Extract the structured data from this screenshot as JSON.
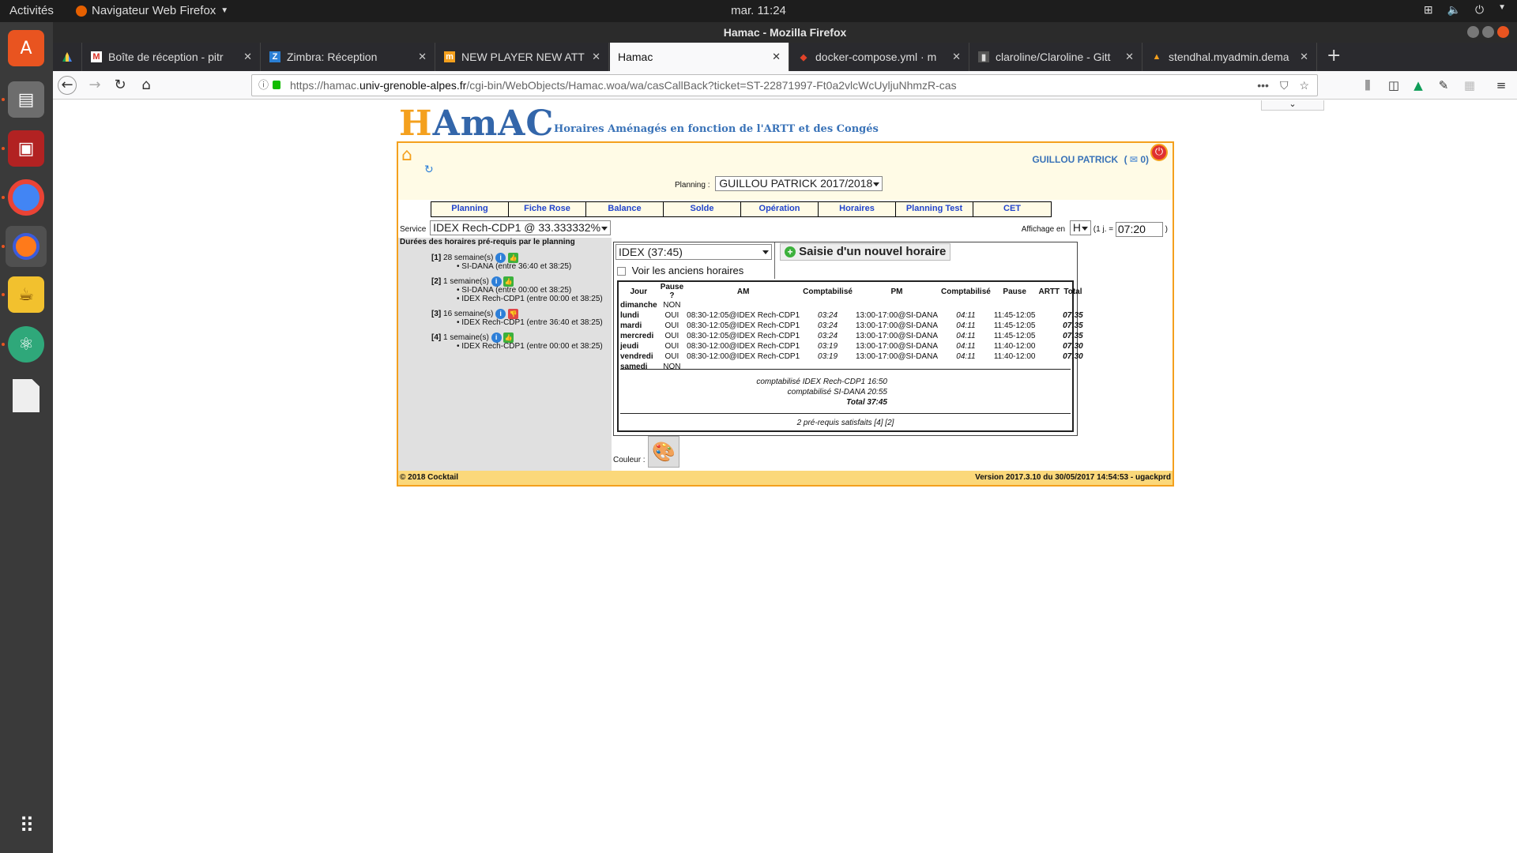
{
  "system": {
    "activities": "Activités",
    "app_menu": "Navigateur Web Firefox",
    "clock": "mar. 11:24"
  },
  "window": {
    "title": "Hamac - Mozilla Firefox"
  },
  "tabs": [
    {
      "label": "Boîte de réception - pitr",
      "icon": "gmail-icon",
      "color": "#d93025"
    },
    {
      "label": "Zimbra: Réception",
      "icon": "zimbra-icon",
      "color": "#2a7fd4"
    },
    {
      "label": "NEW PLAYER NEW ATTIT",
      "icon": "bookmark-icon",
      "color": "#f4a01d"
    },
    {
      "label": "Hamac",
      "icon": "",
      "color": "#ffffff"
    },
    {
      "label": "docker-compose.yml · m",
      "icon": "gitlab-icon",
      "color": "#e24329"
    },
    {
      "label": "claroline/Claroline - Gitt",
      "icon": "gitter-icon",
      "color": "#555555"
    },
    {
      "label": "stendhal.myadmin.dema",
      "icon": "triangle-icon",
      "color": "#f4a01d"
    }
  ],
  "url": {
    "prefix": "https://hamac.",
    "domain": "univ-grenoble-alpes.fr",
    "path": "/cgi-bin/WebObjects/Hamac.woa/wa/casCallBack?ticket=ST-22871997-Ft0a2vlcWcUyljuNhmzR-cas"
  },
  "app": {
    "logo_h": "H",
    "logo_rest": "AmAC",
    "tagline": "Horaires Aménagés en fonction de l'ARTT et des Congés",
    "user": "GUILLOU PATRICK",
    "mail_open": "(",
    "mail_count": "0)",
    "planning_label": "Planning :",
    "planning_value": "GUILLOU PATRICK 2017/2018",
    "menu": [
      "Planning",
      "Fiche Rose",
      "Balance",
      "Solde",
      "Opération",
      "Horaires",
      "Planning Test",
      "CET"
    ],
    "service_label": "Service",
    "service_value": "IDEX Rech-CDP1 @ 33.333332%",
    "affichage_label": "Affichage en",
    "affichage_value": "H",
    "day_label": "(1 j. =",
    "day_value": "07:20",
    "day_close": ")",
    "left_title": "Durées des horaires pré-requis par le planning",
    "prereqs": [
      {
        "num": "[1]",
        "weeks": "28 semaine(s)",
        "ok": true,
        "items": [
          "SI-DANA (entre 36:40 et 38:25)"
        ]
      },
      {
        "num": "[2]",
        "weeks": "1 semaine(s)",
        "ok": true,
        "items": [
          "SI-DANA (entre 00:00 et 38:25)",
          "IDEX Rech-CDP1 (entre 00:00 et 38:25)"
        ]
      },
      {
        "num": "[3]",
        "weeks": "16 semaine(s)",
        "ok": false,
        "items": [
          "IDEX Rech-CDP1 (entre 36:40 et 38:25)"
        ]
      },
      {
        "num": "[4]",
        "weeks": "1 semaine(s)",
        "ok": true,
        "items": [
          "IDEX Rech-CDP1 (entre 00:00 et 38:25)"
        ]
      }
    ],
    "horaire_select": "IDEX (37:45)",
    "new_button": "Saisie d'un nouvel horaire",
    "old_checkbox": "Voir les anciens horaires",
    "table": {
      "headers": [
        "Jour",
        "Pause ?",
        "AM",
        "Comptabilisé",
        "PM",
        "Comptabilisé",
        "Pause",
        "ARTT",
        "Total"
      ],
      "rows": [
        [
          "dimanche",
          "NON",
          "",
          "",
          "",
          "",
          "",
          "",
          ""
        ],
        [
          "lundi",
          "OUI",
          "08:30-12:05@IDEX Rech-CDP1",
          "03:24",
          "13:00-17:00@SI-DANA",
          "04:11",
          "11:45-12:05",
          "",
          "07:35"
        ],
        [
          "mardi",
          "OUI",
          "08:30-12:05@IDEX Rech-CDP1",
          "03:24",
          "13:00-17:00@SI-DANA",
          "04:11",
          "11:45-12:05",
          "",
          "07:35"
        ],
        [
          "mercredi",
          "OUI",
          "08:30-12:05@IDEX Rech-CDP1",
          "03:24",
          "13:00-17:00@SI-DANA",
          "04:11",
          "11:45-12:05",
          "",
          "07:35"
        ],
        [
          "jeudi",
          "OUI",
          "08:30-12:00@IDEX Rech-CDP1",
          "03:19",
          "13:00-17:00@SI-DANA",
          "04:11",
          "11:40-12:00",
          "",
          "07:30"
        ],
        [
          "vendredi",
          "OUI",
          "08:30-12:00@IDEX Rech-CDP1",
          "03:19",
          "13:00-17:00@SI-DANA",
          "04:11",
          "11:40-12:00",
          "",
          "07:30"
        ],
        [
          "samedi",
          "NON",
          "",
          "",
          "",
          "",
          "",
          "",
          ""
        ]
      ],
      "summary": [
        "comptabilisé IDEX Rech-CDP1 16:50",
        "comptabilisé SI-DANA 20:55",
        "Total 37:45"
      ],
      "prereq_status": "2 pré-requis satisfaits [4] [2]"
    },
    "color_label": "Couleur :",
    "footer_left": "© 2018 Cocktail",
    "footer_right": "Version 2017.3.10 du 30/05/2017 14:54:53 - ugackprd"
  }
}
